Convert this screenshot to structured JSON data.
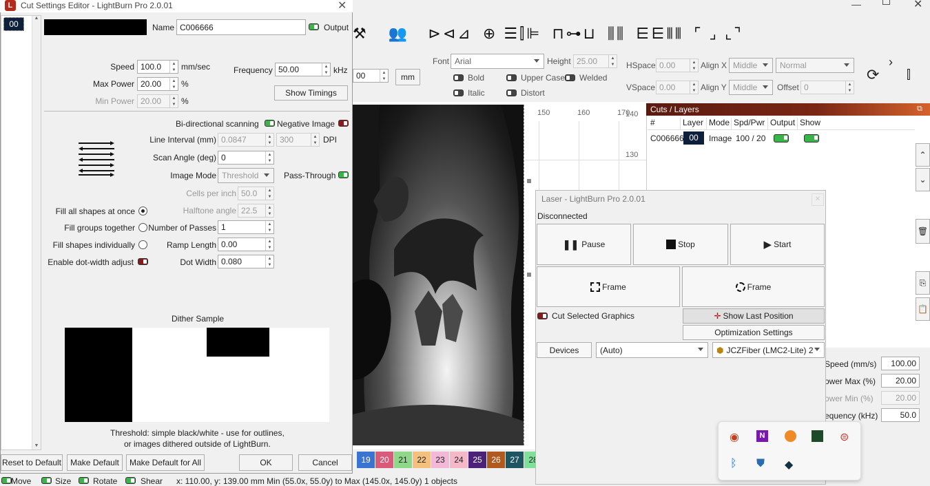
{
  "dialog": {
    "title": "Cut Settings Editor - LightBurn Pro 2.0.01",
    "layer_list_item": "00",
    "name_label": "Name",
    "name_value": "C006666",
    "output_label": "Output",
    "speed_label": "Speed",
    "speed_value": "100.0",
    "speed_unit": "mm/sec",
    "max_power_label": "Max Power",
    "max_power_value": "20.00",
    "max_power_unit": "%",
    "min_power_label": "Min Power",
    "min_power_value": "20.00",
    "min_power_unit": "%",
    "frequency_label": "Frequency",
    "frequency_value": "50.00",
    "frequency_unit": "kHz",
    "show_timings": "Show Timings",
    "bidir_label": "Bi-directional scanning",
    "negative_label": "Negative Image",
    "line_interval_label": "Line Interval (mm)",
    "line_interval_value": "0.0847",
    "dpi_value": "300",
    "dpi_label": "DPI",
    "scan_angle_label": "Scan Angle (deg)",
    "scan_angle_value": "0",
    "image_mode_label": "Image Mode",
    "image_mode_value": "Threshold",
    "pass_through_label": "Pass-Through",
    "cells_label": "Cells per inch",
    "cells_value": "50.0",
    "halftone_label": "Halftone angle",
    "halftone_value": "22.5",
    "fill_all": "Fill all shapes at once",
    "fill_groups": "Fill groups together",
    "fill_individual": "Fill shapes individually",
    "passes_label": "Number of Passes",
    "passes_value": "1",
    "ramp_label": "Ramp Length",
    "ramp_value": "0.00",
    "dot_adjust_label": "Enable dot-width adjust",
    "dot_width_label": "Dot Width",
    "dot_width_value": "0.080",
    "dither_title": "Dither Sample",
    "dither_desc_1": "Threshold: simple black/white - use for outlines,",
    "dither_desc_2": "or images dithered outside of LightBurn.",
    "reset_default": "Reset to Default",
    "make_default": "Make Default",
    "make_default_all": "Make Default for All",
    "ok": "OK",
    "cancel": "Cancel"
  },
  "toolbar": {
    "mm_button": "mm",
    "partial_value": "00",
    "font_label": "Font",
    "font_value": "Arial",
    "height_label": "Height",
    "height_value": "25.00",
    "bold": "Bold",
    "italic": "Italic",
    "upper_case": "Upper Case",
    "welded": "Welded",
    "distort": "Distort",
    "hspace_label": "HSpace",
    "hspace_value": "0.00",
    "vspace_label": "VSpace",
    "vspace_value": "0.00",
    "alignx_label": "Align X",
    "alignx_value": "Middle",
    "aligny_label": "Align Y",
    "aligny_value": "Middle",
    "normal_value": "Normal",
    "offset_label": "Offset",
    "offset_value": "0"
  },
  "ruler": {
    "top_150": "150",
    "top_160": "160",
    "top_170": "170",
    "side_140": "140",
    "side_130": "130"
  },
  "cuts": {
    "title": "Cuts / Layers",
    "headers": [
      "#",
      "Layer",
      "Mode",
      "Spd/Pwr",
      "Output",
      "Show"
    ],
    "row": {
      "name": "C006666",
      "layer": "00",
      "mode": "Image",
      "spdpwr": "100 / 20"
    }
  },
  "laser": {
    "title": "Laser - LightBurn Pro 2.0.01",
    "status": "Disconnected",
    "pause": "Pause",
    "stop": "Stop",
    "start": "Start",
    "frame1": "Frame",
    "frame2": "Frame",
    "cut_selected": "Cut Selected Graphics",
    "show_last": "Show Last Position",
    "optimization": "Optimization Settings",
    "devices": "Devices",
    "auto": "(Auto)",
    "device": "JCZFiber (LMC2-Lite) 2"
  },
  "right_panel": {
    "speed_label": "Speed (mm/s)",
    "speed_value": "100.00",
    "power_max_label": "ower Max (%)",
    "power_max_value": "20.00",
    "power_min_label": "ower Min (%)",
    "power_min_value": "20.00",
    "freq_label": "equency (kHz)",
    "freq_value": "50.0"
  },
  "palette": [
    {
      "n": "19",
      "c": "#3b74d0"
    },
    {
      "n": "20",
      "c": "#d95b7a"
    },
    {
      "n": "21",
      "c": "#8fd88a"
    },
    {
      "n": "22",
      "c": "#f3c07d"
    },
    {
      "n": "23",
      "c": "#f3b8d7"
    },
    {
      "n": "24",
      "c": "#f6b7c8"
    },
    {
      "n": "25",
      "c": "#4a2378"
    },
    {
      "n": "26",
      "c": "#b05a1f"
    },
    {
      "n": "27",
      "c": "#1f5560"
    },
    {
      "n": "28",
      "c": "#7fe09a"
    }
  ],
  "statusbar": {
    "move": "Move",
    "size": "Size",
    "rotate": "Rotate",
    "shear": "Shear",
    "coords": "x: 110.00, y: 139.00 mm   Min (55.0x, 55.0y) to Max (145.0x, 145.0y)  1 objects"
  }
}
